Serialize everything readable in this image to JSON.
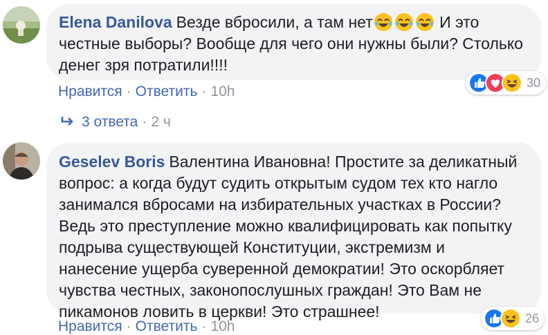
{
  "comments": [
    {
      "author": "Elena Danilova",
      "text_before_emoji": "Везде вбросили, а там нет",
      "emoji_count": 3,
      "emoji_name": "laughing-tears-emoji",
      "text_after_emoji": " И это честные выборы? Вообще для чего они нужны были? Столько денег зря потратили!!!!",
      "actions": {
        "like": "Нравится",
        "reply": "Ответить",
        "time": "10h"
      },
      "reactions": {
        "types": [
          "like",
          "love",
          "haha"
        ],
        "count": "30"
      },
      "replies": {
        "label": "3 ответа",
        "time": "2 ч"
      }
    },
    {
      "author": "Geselev Boris",
      "text": "Валентина Ивановна! Простите за деликатный вопрос: а когда будут судить открытым судом тех кто нагло занимался вбросами на избирательных участках в России? Ведь это преступление можно квалифицировать как попытку подрыва существующей Конституции, экстремизм и нанесение ущерба суверенной демократии! Это оскорбляет чувства честных, законопослушных граждан! Это Вам не пикамонов ловить в церкви! Это страшнее!",
      "actions": {
        "like": "Нравится",
        "reply": "Ответить",
        "time": "10h"
      },
      "reactions": {
        "types": [
          "like",
          "haha"
        ],
        "count": "26"
      }
    }
  ],
  "separator": "·",
  "colors": {
    "link": "#4267b2",
    "author": "#385898",
    "meta": "#90949c",
    "bubble": "#f2f3f5"
  }
}
